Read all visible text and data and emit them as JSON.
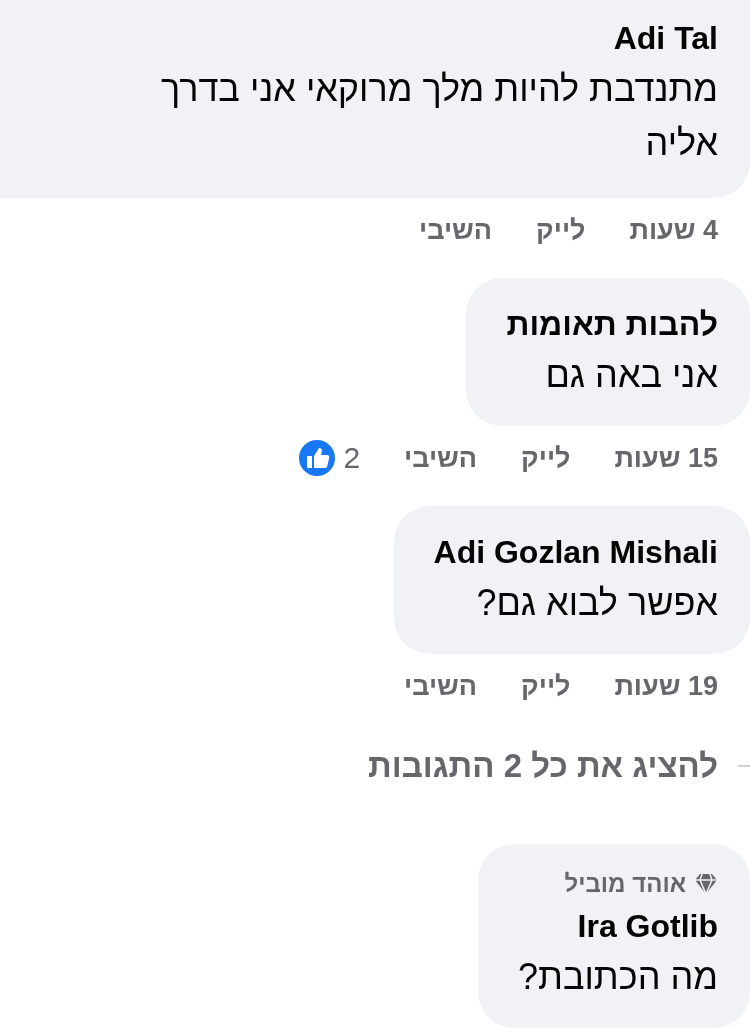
{
  "comments": [
    {
      "author": "Adi Tal",
      "text": "מתנדבת להיות מלך מרוקאי אני בדרך אליה",
      "time": "4 שעות",
      "like": "לייק",
      "reply": "השיבי",
      "cut_top": true
    },
    {
      "author": "להבות תאומות",
      "text": "אני באה גם",
      "time": "15 שעות",
      "like": "לייק",
      "reply": "השיבי",
      "reactions": "2"
    },
    {
      "author": "Adi Gozlan Mishali",
      "text": "אפשר לבוא גם?",
      "time": "19 שעות",
      "like": "לייק",
      "reply": "השיבי"
    }
  ],
  "show_replies": "להציג את כל 2 התגובות",
  "reply_comments": [
    {
      "badge": "אוהד מוביל",
      "author": "Ira Gotlib",
      "text": "מה הכתובת?"
    }
  ]
}
